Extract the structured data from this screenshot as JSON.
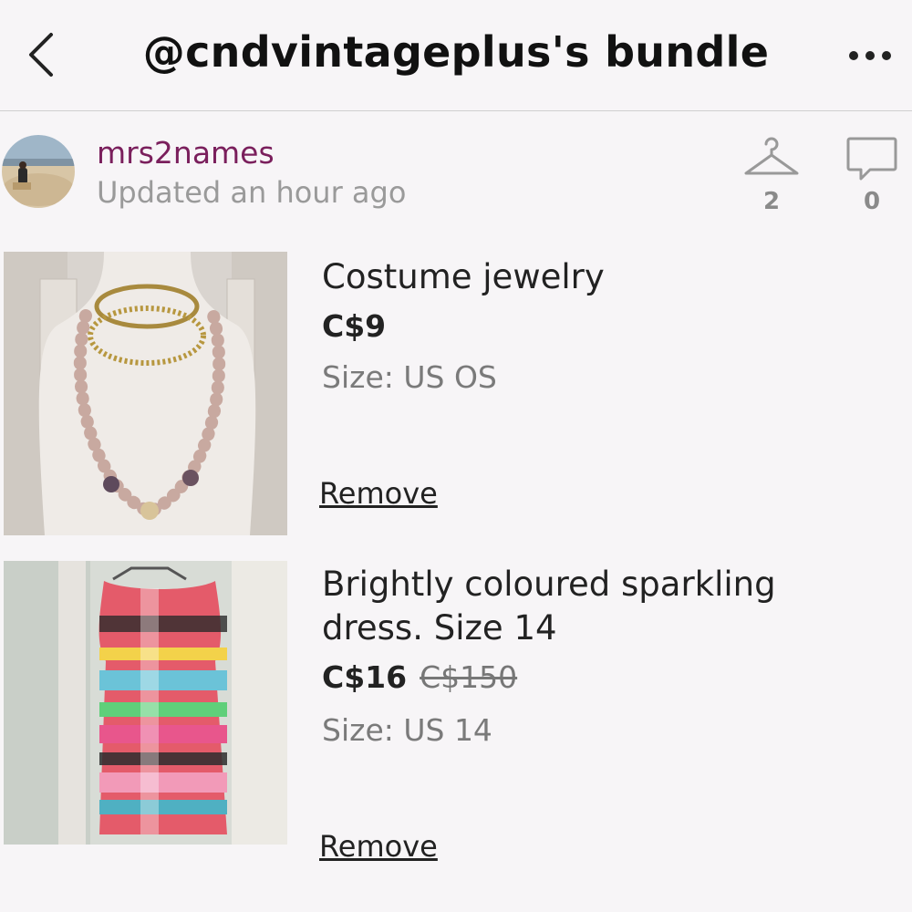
{
  "header": {
    "title": "@cndvintageplus's bundle",
    "back_icon": "chevron-left-icon",
    "more_icon": "more-horizontal-icon"
  },
  "seller": {
    "username": "mrs2names",
    "updated": "Updated an hour ago",
    "likes_count": "2",
    "comments_count": "0",
    "username_color": "#7a1f5c"
  },
  "items": [
    {
      "title": "Costume jewelry",
      "price": "C$9",
      "original_price": "",
      "size": "Size: US OS",
      "remove_label": "Remove"
    },
    {
      "title": "Brightly coloured sparkling dress. Size 14",
      "price": "C$16",
      "original_price": "C$150",
      "size": "Size: US 14",
      "remove_label": "Remove"
    }
  ]
}
